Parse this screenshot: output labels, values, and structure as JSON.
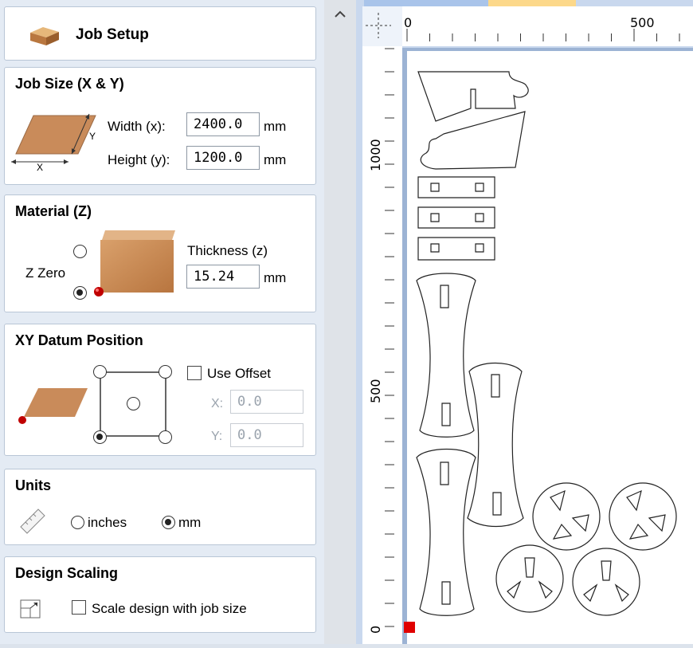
{
  "job_setup": {
    "title": "Job Setup"
  },
  "job_size": {
    "title": "Job Size (X & Y)",
    "width_label": "Width (x):",
    "width_value": "2400.0",
    "height_label": "Height (y):",
    "height_value": "1200.0",
    "unit": "mm",
    "diagram_x": "X",
    "diagram_y": "Y"
  },
  "material": {
    "title": "Material (Z)",
    "z_zero_label": "Z Zero",
    "thickness_label": "Thickness (z)",
    "thickness_value": "15.24",
    "unit": "mm",
    "z_zero_selected": "bottom"
  },
  "xy_datum": {
    "title": "XY Datum Position",
    "use_offset_label": "Use Offset",
    "use_offset_checked": false,
    "x_label": "X:",
    "x_value": "0.0",
    "y_label": "Y:",
    "y_value": "0.0",
    "selected": "bottom-left"
  },
  "units": {
    "title": "Units",
    "inches_label": "inches",
    "mm_label": "mm",
    "selected": "mm"
  },
  "design_scaling": {
    "title": "Design Scaling",
    "scale_label": "Scale design with job size",
    "checked": false
  },
  "ruler": {
    "top_labels": [
      "0",
      "500"
    ],
    "left_labels": [
      "1000",
      "500",
      "0"
    ]
  },
  "colors": {
    "panel_bg": "#e4ebf4",
    "card_border": "#b9c6d6",
    "wood": "#c98b5a",
    "origin_marker": "#e00000"
  }
}
